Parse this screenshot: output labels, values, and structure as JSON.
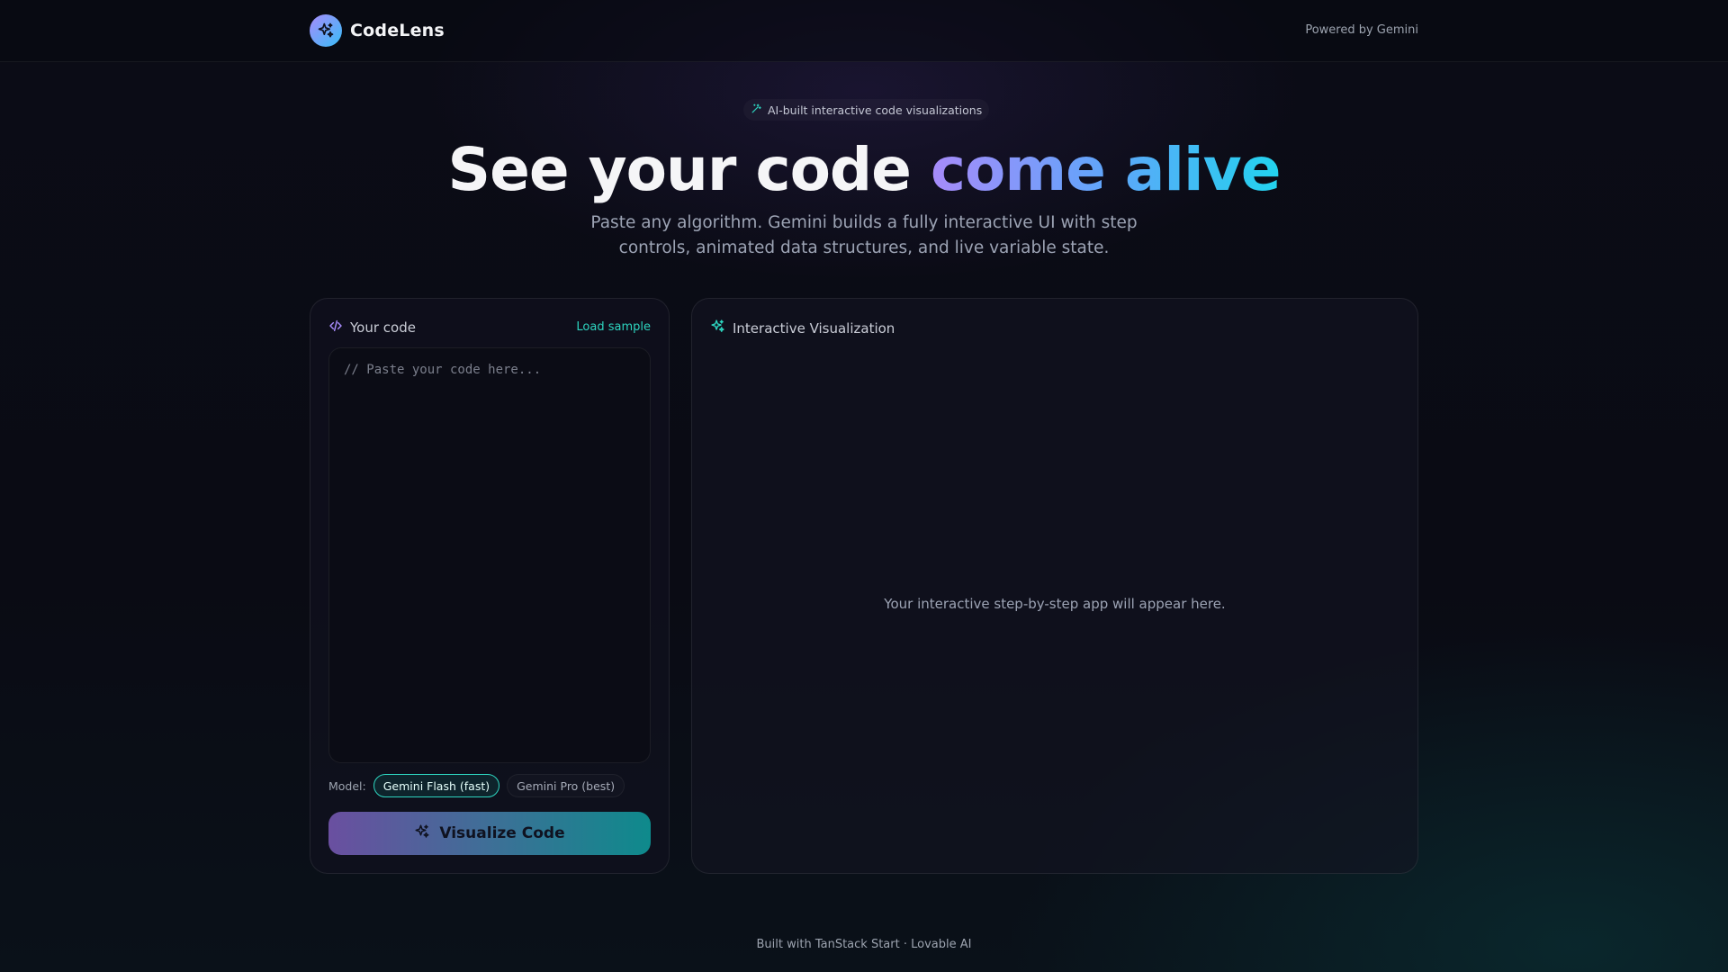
{
  "header": {
    "brand_name": "CodeLens",
    "powered_by": "Powered by Gemini"
  },
  "hero": {
    "pill_text": "AI-built interactive code visualizations",
    "title_plain": "See your code ",
    "title_highlight": "come alive",
    "subtitle": "Paste any algorithm. Gemini builds a fully interactive UI with step controls, animated data structures, and live variable state."
  },
  "editor": {
    "title": "Your code",
    "load_sample": "Load sample",
    "placeholder": "// Paste your code here...",
    "value": "",
    "model_label": "Model:",
    "models": [
      {
        "label": "Gemini Flash (fast)",
        "selected": true
      },
      {
        "label": "Gemini Pro (best)",
        "selected": false
      }
    ],
    "visualize_label": "Visualize Code"
  },
  "visualization": {
    "title": "Interactive Visualization",
    "empty_text": "Your interactive step-by-step app will appear here."
  },
  "footer": {
    "text": "Built with TanStack Start · Lovable AI"
  },
  "colors": {
    "accent_teal": "#2dd4bf",
    "accent_purple": "#a78bfa",
    "accent_cyan": "#22d3ee",
    "background": "#0a0b14"
  },
  "icons": {
    "brand": "sparkles-icon",
    "pill": "magic-wand-icon",
    "editor": "code-icon",
    "visualization": "sparkles-icon",
    "button": "sparkles-icon"
  }
}
